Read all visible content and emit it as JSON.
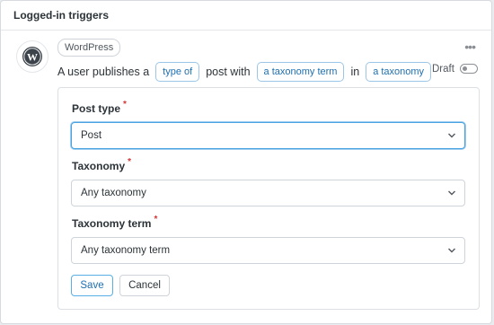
{
  "header": {
    "title": "Logged-in triggers"
  },
  "trigger": {
    "source": "WordPress",
    "icon": "wordpress-icon",
    "sentence": {
      "part1": "A user publishes a",
      "token1": "type of",
      "part2": "post with",
      "token2": "a taxonomy term",
      "part3": "in",
      "token3": "a taxonomy"
    },
    "status_label": "Draft",
    "status_on": false
  },
  "form": {
    "fields": [
      {
        "label": "Post type",
        "required_mark": "*",
        "value": "Post"
      },
      {
        "label": "Taxonomy",
        "required_mark": "*",
        "value": "Any taxonomy"
      },
      {
        "label": "Taxonomy term",
        "required_mark": "*",
        "value": "Any taxonomy term"
      }
    ],
    "save_label": "Save",
    "cancel_label": "Cancel"
  },
  "colors": {
    "accent": "#1e6fb0",
    "required": "#d63638",
    "focus": "#4aa3e0"
  }
}
